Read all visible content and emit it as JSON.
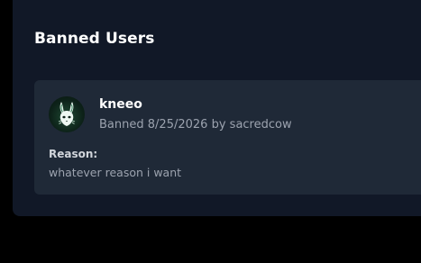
{
  "panel": {
    "title": "Banned Users"
  },
  "bans": [
    {
      "username": "kneeo",
      "banned_prefix": "Banned",
      "banned_date": "8/25/2026",
      "banned_by_prefix": "by",
      "banned_by": "sacredcow",
      "reason_label": "Reason:",
      "reason": "whatever reason i want",
      "avatar_icon": "rabbit-icon"
    }
  ],
  "colors": {
    "page_background": "#000000",
    "panel_background": "#111827",
    "card_background": "#1f2937",
    "primary_text": "#ffffff",
    "muted_text": "#9ca3af",
    "label_text": "#d1d5db",
    "avatar_green": "#1f4a33"
  }
}
